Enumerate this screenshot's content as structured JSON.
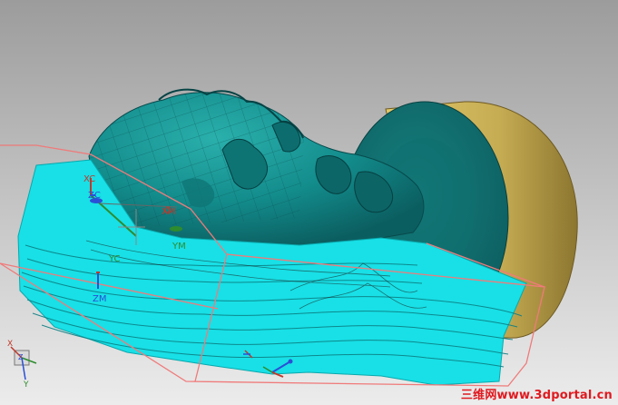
{
  "viewport": {
    "background_top": "#9e9e9e",
    "background_bottom": "#e9e9e9",
    "model_color": "#138c8c",
    "base_color": "#c9b25a",
    "toolpath_color": "#18e0e6",
    "blank_outline_color": "#f08080"
  },
  "axes": {
    "xc": "XC",
    "yc": "YC",
    "zc": "ZC",
    "xm": "XM",
    "ym": "YM",
    "zm": "ZM"
  },
  "view_triad": {
    "x": "X",
    "y": "Y",
    "z": "Z"
  },
  "watermark": "三维网www.3dportal.cn"
}
